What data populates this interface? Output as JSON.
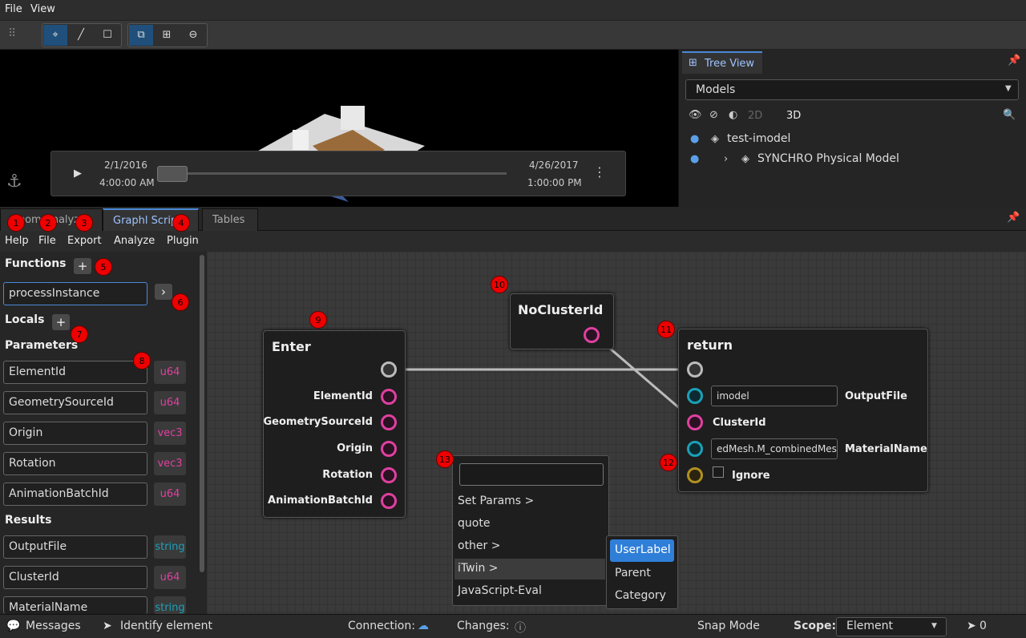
{
  "menubar": {
    "items": [
      "File",
      "View"
    ]
  },
  "timeline": {
    "start_date": "2/1/2016",
    "start_time": "4:00:00 AM",
    "end_date": "4/26/2017",
    "end_time": "1:00:00 PM",
    "progress": 0
  },
  "tree_view": {
    "tab_label": "Tree View",
    "select_value": "Models",
    "view_2d": "2D",
    "view_3d": "3D",
    "items": [
      {
        "label": "test-imodel"
      },
      {
        "label": "SYNCHRO Physical Model"
      }
    ]
  },
  "bottom_tabs": [
    "Geom Analyz",
    "Graphl Script",
    "Tables"
  ],
  "graph_menu": [
    "Help",
    "File",
    "Export",
    "Analyze",
    "Plugin"
  ],
  "sidebar": {
    "functions_label": "Functions",
    "function_value": "processInstance",
    "locals_label": "Locals",
    "parameters_label": "Parameters",
    "parameters": [
      {
        "name": "ElementId",
        "type": "u64",
        "color": "#e040a0"
      },
      {
        "name": "GeometrySourceId",
        "type": "u64",
        "color": "#e040a0"
      },
      {
        "name": "Origin",
        "type": "vec3",
        "color": "#e040a0"
      },
      {
        "name": "Rotation",
        "type": "vec3",
        "color": "#e040a0"
      },
      {
        "name": "AnimationBatchId",
        "type": "u64",
        "color": "#e040a0"
      }
    ],
    "results_label": "Results",
    "results": [
      {
        "name": "OutputFile",
        "type": "string",
        "color": "#1aa0b8"
      },
      {
        "name": "ClusterId",
        "type": "u64",
        "color": "#e040a0"
      },
      {
        "name": "MaterialName",
        "type": "string",
        "color": "#1aa0b8"
      }
    ]
  },
  "nodes": {
    "enter": {
      "title": "Enter",
      "pins": [
        "ElementId",
        "GeometrySourceId",
        "Origin",
        "Rotation",
        "AnimationBatchId"
      ]
    },
    "nocluster": {
      "title": "NoClusterId"
    },
    "return": {
      "title": "return",
      "output_file_value": "imodel",
      "output_file_label": "OutputFile",
      "cluster_label": "ClusterId",
      "material_value": "edMesh.M_combinedMesh",
      "material_label": "MaterialName",
      "ignore_label": "Ignore"
    }
  },
  "context_menu": {
    "search_value": "",
    "items": [
      "Set Params >",
      "quote",
      "other >",
      "iTwin >",
      "JavaScript-Eval"
    ],
    "submenu": [
      "UserLabel",
      "Parent",
      "Category"
    ]
  },
  "badges": [
    "1",
    "2",
    "3",
    "4",
    "5",
    "6",
    "7",
    "8",
    "9",
    "10",
    "11",
    "12",
    "13"
  ],
  "statusbar": {
    "messages": "Messages",
    "identify": "Identify element",
    "connection": "Connection:",
    "changes": "Changes:",
    "snap_mode": "Snap Mode",
    "scope_label": "Scope:",
    "scope_value": "Element",
    "selection_count": "0"
  },
  "colors": {
    "accent": "#4a8ad8",
    "pink_pin": "#e040a0",
    "teal_pin": "#1aa0b8",
    "gold_pin": "#b09020"
  }
}
